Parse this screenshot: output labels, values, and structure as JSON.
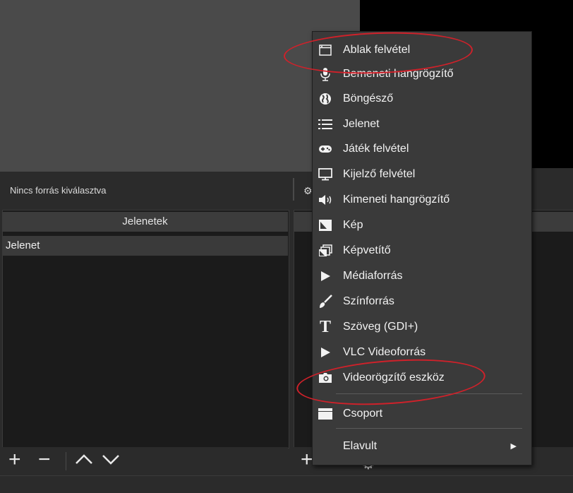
{
  "status_bar": {
    "text": "Nincs forrás kiválasztva"
  },
  "scenes": {
    "header": "Jelenetek",
    "items": [
      "Jelenet"
    ],
    "toolbar": {
      "add": "+",
      "remove": "−",
      "up": "∧",
      "down": "∨"
    }
  },
  "sources": {
    "toolbar": {
      "add": "+"
    }
  },
  "context_menu": {
    "items": [
      {
        "label": "Ablak felvétel",
        "icon": "window-icon"
      },
      {
        "label": "Bemeneti hangrögzítő",
        "icon": "microphone-icon"
      },
      {
        "label": "Böngésző",
        "icon": "globe-icon"
      },
      {
        "label": "Jelenet",
        "icon": "list-icon"
      },
      {
        "label": "Játék felvétel",
        "icon": "gamepad-icon"
      },
      {
        "label": "Kijelző felvétel",
        "icon": "monitor-icon"
      },
      {
        "label": "Kimeneti hangrögzítő",
        "icon": "speaker-icon"
      },
      {
        "label": "Kép",
        "icon": "image-icon"
      },
      {
        "label": "Képvetítő",
        "icon": "slideshow-icon"
      },
      {
        "label": "Médiaforrás",
        "icon": "play-icon"
      },
      {
        "label": "Színforrás",
        "icon": "brush-icon"
      },
      {
        "label": "Szöveg (GDI+)",
        "icon": "text-icon"
      },
      {
        "label": "VLC Videoforrás",
        "icon": "play-icon"
      },
      {
        "label": "Videorögzítő eszköz",
        "icon": "camera-icon"
      }
    ],
    "group_item": {
      "label": "Csoport",
      "icon": "folder-icon"
    },
    "deprecated_item": {
      "label": "Elavult",
      "submenu_arrow": "▶"
    }
  },
  "colors": {
    "annotation": "#d0212a",
    "menu_bg": "#3a3a3a",
    "preview_bg": "#4a4a4a"
  }
}
